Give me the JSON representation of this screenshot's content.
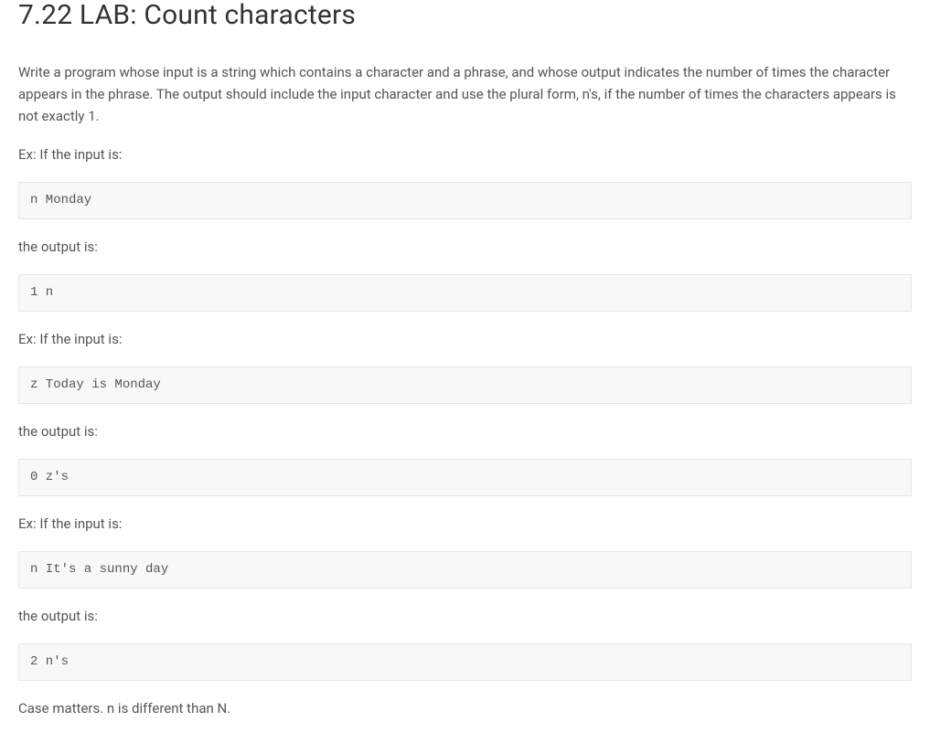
{
  "title": "7.22 LAB: Count characters",
  "intro": "Write a program whose input is a string which contains a character and a phrase, and whose output indicates the number of times the character appears in the phrase. The output should include the input character and use the plural form, n's, if the number of times the characters appears is not exactly 1.",
  "labels": {
    "ex_input": "Ex: If the input is:",
    "output_is": "the output is:"
  },
  "examples": [
    {
      "input": "n Monday",
      "output": "1 n"
    },
    {
      "input": "z Today is Monday",
      "output": "0 z's"
    },
    {
      "input": "n It's a sunny day",
      "output": "2 n's"
    }
  ],
  "footer": "Case matters. n is different than N."
}
